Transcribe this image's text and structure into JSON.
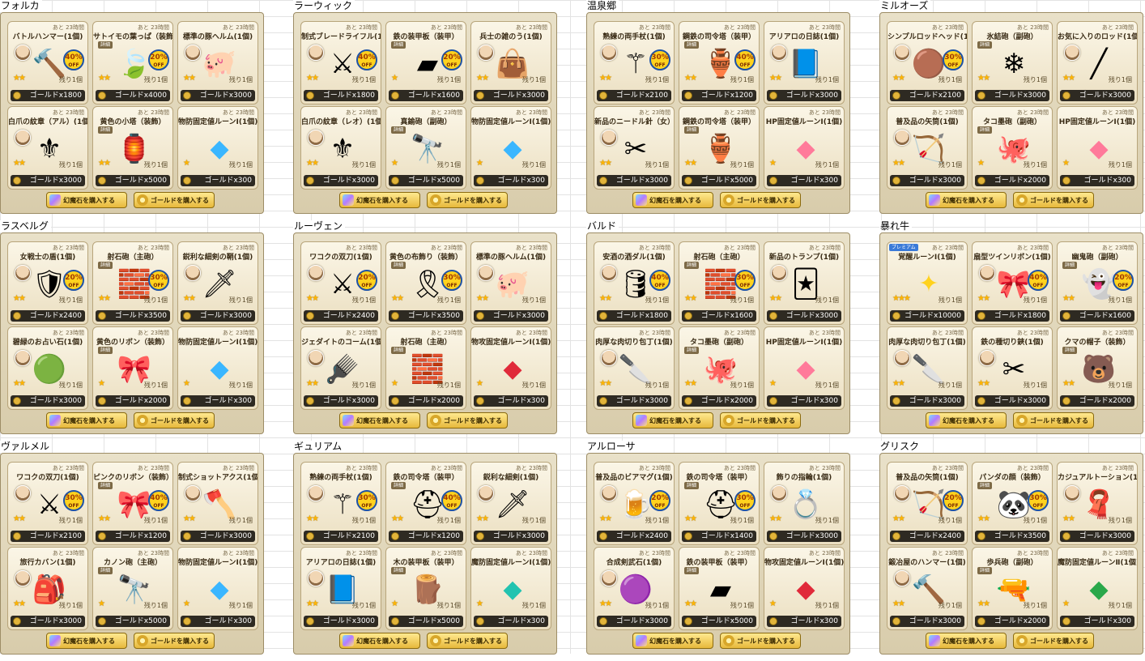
{
  "buttons": {
    "stone_label": "幻魔石を購入する",
    "gold_label": "ゴールドを購入する"
  },
  "common": {
    "remain_label": "あと 23時間",
    "detail_label": "詳細",
    "off_label": "OFF"
  },
  "shops": [
    {
      "title": "フォルカ",
      "items": [
        {
          "name": "バトルハンマー(1個)",
          "icon": "hammer-icon",
          "discount": "40%",
          "stars": "★★",
          "stock": "残り1個",
          "price": "ゴールドx1800",
          "portrait": true
        },
        {
          "name": "サトイモの葉っぱ（装飾）",
          "icon": "leaf-hat-icon",
          "discount": "20%",
          "stars": "★★",
          "stock": "残り1個",
          "price": "ゴールドx4000",
          "detail": true
        },
        {
          "name": "標準の豚ヘルム(1個)",
          "icon": "pig-helm-icon",
          "stars": "★★",
          "stock": "残り1個",
          "price": "ゴールドx3000",
          "portrait": true
        },
        {
          "name": "白爪の紋章（アル）(1個)",
          "icon": "crest-icon",
          "stars": "★★",
          "stock": "残り1個",
          "price": "ゴールドx3000",
          "portrait": true
        },
        {
          "name": "黄色の小塔（装飾）",
          "icon": "yellow-tower-icon",
          "stars": "★★",
          "stock": "残り1個",
          "price": "ゴールドx5000",
          "detail": true
        },
        {
          "name": "物防固定値ルーンⅠ(1個)",
          "icon": "blue-rune-icon",
          "stars": "★",
          "stock": "残り1個",
          "price": "ゴールドx300"
        }
      ]
    },
    {
      "title": "ラーウィック",
      "items": [
        {
          "name": "制式ブレードライフル(1個)",
          "icon": "blade-rifle-icon",
          "discount": "40%",
          "stars": "★★",
          "stock": "残り1個",
          "price": "ゴールドx1800",
          "portrait": true
        },
        {
          "name": "鉄の装甲板（装甲）",
          "icon": "armor-plate-icon",
          "discount": "20%",
          "stars": "★",
          "stock": "残り1個",
          "price": "ゴールドx1600",
          "detail": true
        },
        {
          "name": "兵士の雑のう(1個)",
          "icon": "bag-icon",
          "stars": "★★",
          "stock": "残り1個",
          "price": "ゴールドx3000",
          "portrait": true
        },
        {
          "name": "白爪の紋章（レオ）(1個)",
          "icon": "crest-icon",
          "stars": "★★",
          "stock": "残り1個",
          "price": "ゴールドx3000",
          "portrait": true
        },
        {
          "name": "真鍮砲（副砲）",
          "icon": "cannon-icon",
          "stars": "★",
          "stock": "残り1個",
          "price": "ゴールドx5000",
          "detail": true
        },
        {
          "name": "物防固定値ルーンⅠ(1個)",
          "icon": "blue-rune-icon",
          "stars": "★",
          "stock": "残り1個",
          "price": "ゴールドx300"
        }
      ]
    },
    {
      "title": "温泉郷",
      "items": [
        {
          "name": "熟練の両手杖(1個)",
          "icon": "staff-icon",
          "discount": "30%",
          "stars": "★★",
          "stock": "残り1個",
          "price": "ゴールドx2100",
          "portrait": true
        },
        {
          "name": "鋼鉄の司令塔（装甲）",
          "icon": "command-tower-icon",
          "discount": "40%",
          "stars": "★★",
          "stock": "残り1個",
          "price": "ゴールドx1200",
          "detail": true
        },
        {
          "name": "アリアロの日誌(1個)",
          "icon": "journal-icon",
          "stars": "★★",
          "stock": "残り1個",
          "price": "ゴールドx3000",
          "portrait": true
        },
        {
          "name": "新品のニードル針（女）(1個)",
          "icon": "needles-icon",
          "stars": "★★",
          "stock": "残り1個",
          "price": "ゴールドx3000",
          "portrait": true
        },
        {
          "name": "鋼鉄の司令塔（装甲）",
          "icon": "command-tower-icon",
          "stars": "★★",
          "stock": "残り1個",
          "price": "ゴールドx5000",
          "detail": true
        },
        {
          "name": "HP固定値ルーンⅠ(1個)",
          "icon": "pink-rune-icon",
          "stars": "★",
          "stock": "残り1個",
          "price": "ゴールドx300"
        }
      ]
    },
    {
      "title": "ミルオーズ",
      "items": [
        {
          "name": "シンプルロッドヘッド(1個)",
          "icon": "rod-head-icon",
          "discount": "30%",
          "stars": "★★",
          "stock": "残り1個",
          "price": "ゴールドx2100",
          "portrait": true
        },
        {
          "name": "氷結砲（副砲）",
          "icon": "ice-cannon-icon",
          "stars": "★★",
          "stock": "残り1個",
          "price": "ゴールドx3000",
          "detail": true
        },
        {
          "name": "お気に入りのロッド(1個)",
          "icon": "rod-icon",
          "stars": "★★",
          "stock": "残り1個",
          "price": "ゴールドx3000",
          "portrait": true
        },
        {
          "name": "普及品の矢筒(1個)",
          "icon": "quiver-icon",
          "stars": "★★",
          "stock": "残り1個",
          "price": "ゴールドx3000",
          "portrait": true
        },
        {
          "name": "タコ墨砲（副砲）",
          "icon": "octopus-cannon-icon",
          "stars": "★",
          "stock": "残り1個",
          "price": "ゴールドx2000",
          "detail": true
        },
        {
          "name": "HP固定値ルーンⅠ(1個)",
          "icon": "pink-rune-icon",
          "stars": "★",
          "stock": "残り1個",
          "price": "ゴールドx300"
        }
      ]
    },
    {
      "title": "ラスベルグ",
      "items": [
        {
          "name": "女戦士の盾(1個)",
          "icon": "shield-icon",
          "discount": "20%",
          "stars": "★★",
          "stock": "残り1個",
          "price": "ゴールドx2400",
          "portrait": true
        },
        {
          "name": "射石砲（主砲）",
          "icon": "stone-cannon-icon",
          "discount": "30%",
          "stars": "★★",
          "stock": "残り1個",
          "price": "ゴールドx3500",
          "detail": true
        },
        {
          "name": "鋭利な細剣の鞘(1個)",
          "icon": "sheath-icon",
          "stars": "★★",
          "stock": "残り1個",
          "price": "ゴールドx3000",
          "portrait": true
        },
        {
          "name": "碧緑のお占い石(1個)",
          "icon": "green-orb-icon",
          "stars": "★★",
          "stock": "残り1個",
          "price": "ゴールドx3000",
          "portrait": true
        },
        {
          "name": "黄色のリボン（装飾）",
          "icon": "yellow-ribbon-icon",
          "stars": "★",
          "stock": "残り1個",
          "price": "ゴールドx2000",
          "detail": true
        },
        {
          "name": "物防固定値ルーンⅠ(1個)",
          "icon": "blue-rune-icon",
          "stars": "★",
          "stock": "残り1個",
          "price": "ゴールドx300"
        }
      ]
    },
    {
      "title": "ルーヴェン",
      "items": [
        {
          "name": "ワコクの双刀(1個)",
          "icon": "twin-blades-icon",
          "discount": "20%",
          "stars": "★★",
          "stock": "残り1個",
          "price": "ゴールドx2400",
          "portrait": true
        },
        {
          "name": "黄色の布飾り（装飾）",
          "icon": "yellow-cloth-icon",
          "discount": "30%",
          "stars": "★★",
          "stock": "残り1個",
          "price": "ゴールドx3500",
          "detail": true
        },
        {
          "name": "標準の豚ヘルム(1個)",
          "icon": "pig-helm-icon",
          "stars": "★★",
          "stock": "残り1個",
          "price": "ゴールドx3000",
          "portrait": true
        },
        {
          "name": "ジェダイトのコーム(1個)",
          "icon": "comb-icon",
          "stars": "★★",
          "stock": "残り1個",
          "price": "ゴールドx3000",
          "portrait": true
        },
        {
          "name": "射石砲（主砲）",
          "icon": "stone-cannon-icon",
          "stars": "★",
          "stock": "残り1個",
          "price": "ゴールドx2000",
          "detail": true
        },
        {
          "name": "物攻固定値ルーンⅠ(1個)",
          "icon": "red-rune-icon",
          "stars": "★",
          "stock": "残り1個",
          "price": "ゴールドx300"
        }
      ]
    },
    {
      "title": "バルド",
      "items": [
        {
          "name": "安酒の酒ダル(1個)",
          "icon": "barrel-icon",
          "discount": "40%",
          "stars": "★★",
          "stock": "残り1個",
          "price": "ゴールドx1800",
          "portrait": true
        },
        {
          "name": "射石砲（主砲）",
          "icon": "stone-cannon-icon",
          "discount": "30%",
          "stars": "★★",
          "stock": "残り1個",
          "price": "ゴールドx1600",
          "detail": true
        },
        {
          "name": "新品のトランプ(1個)",
          "icon": "cards-icon",
          "stars": "★★",
          "stock": "残り1個",
          "price": "ゴールドx3000",
          "portrait": true
        },
        {
          "name": "肉厚な肉切り包丁(1個)",
          "icon": "cleaver-icon",
          "stars": "★★",
          "stock": "残り1個",
          "price": "ゴールドx3000",
          "portrait": true
        },
        {
          "name": "タコ墨砲（副砲）",
          "icon": "octopus-cannon-icon",
          "stars": "★★",
          "stock": "残り1個",
          "price": "ゴールドx2000",
          "detail": true
        },
        {
          "name": "HP固定値ルーンⅠ(1個)",
          "icon": "pink-rune-icon",
          "stars": "★",
          "stock": "残り1個",
          "price": "ゴールドx300"
        }
      ]
    },
    {
      "title": "暴れ牛",
      "items": [
        {
          "name": "覚醒ルーンⅠ(1個)",
          "icon": "awakening-rune-icon",
          "stars": "★★★",
          "stock": "残り1個",
          "price": "ゴールドx10000",
          "badge": "プレミアム"
        },
        {
          "name": "扇型ツインリボン(1個)",
          "icon": "twin-ribbon-icon",
          "discount": "40%",
          "stars": "★★",
          "stock": "残り1個",
          "price": "ゴールドx1800",
          "portrait": true
        },
        {
          "name": "幽鬼砲（副砲）",
          "icon": "ghost-cannon-icon",
          "discount": "20%",
          "stars": "★★",
          "stock": "残り1個",
          "price": "ゴールドx1600",
          "detail": true
        },
        {
          "name": "肉厚な肉切り包丁(1個)",
          "icon": "cleaver-icon",
          "stars": "★★",
          "stock": "残り1個",
          "price": "ゴールドx3000",
          "portrait": true
        },
        {
          "name": "鉄の種切り鋏(1個)",
          "icon": "scissors-icon",
          "stars": "★★",
          "stock": "残り1個",
          "price": "ゴールドx3000",
          "portrait": true
        },
        {
          "name": "クマの帽子（装飾）",
          "icon": "bear-hat-icon",
          "stars": "★★",
          "stock": "残り1個",
          "price": "ゴールドx2000",
          "detail": true
        }
      ]
    },
    {
      "title": "ヴァルメル",
      "items": [
        {
          "name": "ワコクの双刀(1個)",
          "icon": "twin-blades-icon",
          "discount": "30%",
          "stars": "★★",
          "stock": "残り1個",
          "price": "ゴールドx2100",
          "portrait": true
        },
        {
          "name": "ピンクのリボン（装飾）",
          "icon": "pink-ribbon-icon",
          "discount": "40%",
          "stars": "★★",
          "stock": "残り1個",
          "price": "ゴールドx1200",
          "detail": true
        },
        {
          "name": "制式ショットアクス(1個)",
          "icon": "axe-icon",
          "stars": "★★",
          "stock": "残り1個",
          "price": "ゴールドx3000",
          "portrait": true
        },
        {
          "name": "旅行カバン(1個)",
          "icon": "travel-bag-icon",
          "stars": "★★",
          "stock": "残り1個",
          "price": "ゴールドx3000",
          "portrait": true
        },
        {
          "name": "カノン砲（主砲）",
          "icon": "cannon-icon",
          "stars": "★",
          "stock": "残り1個",
          "price": "ゴールドx5000",
          "detail": true
        },
        {
          "name": "物防固定値ルーンⅠ(1個)",
          "icon": "blue-rune-icon",
          "stars": "★",
          "stock": "残り1個",
          "price": "ゴールドx300"
        }
      ]
    },
    {
      "title": "ギュリアム",
      "items": [
        {
          "name": "熟練の両手杖(1個)",
          "icon": "staff-icon",
          "discount": "30%",
          "stars": "★★",
          "stock": "残り1個",
          "price": "ゴールドx2100",
          "portrait": true
        },
        {
          "name": "鉄の司令塔（装甲）",
          "icon": "iron-tower-icon",
          "discount": "40%",
          "stars": "★★",
          "stock": "残り1個",
          "price": "ゴールドx1200",
          "detail": true
        },
        {
          "name": "鋭利な細剣(1個)",
          "icon": "rapier-icon",
          "stars": "★★",
          "stock": "残り1個",
          "price": "ゴールドx3000",
          "portrait": true
        },
        {
          "name": "アリアロの日誌(1個)",
          "icon": "journal-icon",
          "stars": "★★",
          "stock": "残り1個",
          "price": "ゴールドx3000",
          "portrait": true
        },
        {
          "name": "木の装甲板（装甲）",
          "icon": "wood-armor-icon",
          "stars": "★",
          "stock": "残り1個",
          "price": "ゴールドx5000",
          "detail": true
        },
        {
          "name": "魔防固定値ルーンⅠ(1個)",
          "icon": "teal-rune-icon",
          "stars": "★",
          "stock": "残り1個",
          "price": "ゴールドx300"
        }
      ]
    },
    {
      "title": "アルローサ",
      "items": [
        {
          "name": "普及品のビアマグ(1個)",
          "icon": "beer-mug-icon",
          "discount": "20%",
          "stars": "★★",
          "stock": "残り1個",
          "price": "ゴールドx2400",
          "portrait": true
        },
        {
          "name": "鉄の司令塔（装甲）",
          "icon": "iron-tower-icon",
          "discount": "30%",
          "stars": "★★",
          "stock": "残り1個",
          "price": "ゴールドx1400",
          "detail": true
        },
        {
          "name": "飾りの指輪(1個)",
          "icon": "ring-icon",
          "stars": "★★",
          "stock": "残り1個",
          "price": "ゴールドx3000",
          "portrait": true
        },
        {
          "name": "合成剣武石(1個)",
          "icon": "purple-orb-icon",
          "stars": "★★",
          "stock": "残り1個",
          "price": "ゴールドx3000",
          "portrait": true
        },
        {
          "name": "鉄の装甲板（装甲）",
          "icon": "armor-plate-icon",
          "stars": "★★",
          "stock": "残り1個",
          "price": "ゴールドx5000",
          "detail": true
        },
        {
          "name": "物攻固定値ルーンⅠ(1個)",
          "icon": "red-rune-icon",
          "stars": "★",
          "stock": "残り1個",
          "price": "ゴールドx300"
        }
      ]
    },
    {
      "title": "グリスク",
      "items": [
        {
          "name": "普及品の矢筒(1個)",
          "icon": "quiver-icon",
          "discount": "20%",
          "stars": "★★",
          "stock": "残り1個",
          "price": "ゴールドx2400",
          "portrait": true
        },
        {
          "name": "パンダの顔（装飾）",
          "icon": "panda-face-icon",
          "discount": "30%",
          "stars": "★★",
          "stock": "残り1個",
          "price": "ゴールドx3500",
          "detail": true
        },
        {
          "name": "カジュアルトーション(1個)",
          "icon": "scarf-icon",
          "stars": "★★",
          "stock": "残り1個",
          "price": "ゴールドx3000",
          "portrait": true
        },
        {
          "name": "鍛冶屋のハンマー(1個)",
          "icon": "smith-hammer-icon",
          "stars": "★★",
          "stock": "残り1個",
          "price": "ゴールドx3000",
          "portrait": true
        },
        {
          "name": "歩兵砲（副砲）",
          "icon": "infantry-cannon-icon",
          "stars": "★★",
          "stock": "残り1個",
          "price": "ゴールドx2000",
          "detail": true
        },
        {
          "name": "魔防固定値ルーンⅡ(1個)",
          "icon": "green-rune-icon",
          "stars": "★",
          "stock": "残り1個",
          "price": "ゴールドx300"
        }
      ]
    }
  ],
  "icon_glyphs": {
    "hammer-icon": "🔨",
    "leaf-hat-icon": "🍃",
    "pig-helm-icon": "🐖",
    "crest-icon": "⚜",
    "yellow-tower-icon": "🏮",
    "blue-rune-icon": "◆",
    "blade-rifle-icon": "⚔",
    "armor-plate-icon": "▰",
    "bag-icon": "👜",
    "cannon-icon": "🔭",
    "staff-icon": "⚚",
    "command-tower-icon": "🏺",
    "journal-icon": "📘",
    "needles-icon": "✂",
    "pink-rune-icon": "◆",
    "rod-head-icon": "🟤",
    "ice-cannon-icon": "❄",
    "rod-icon": "╱",
    "quiver-icon": "🏹",
    "octopus-cannon-icon": "🐙",
    "shield-icon": "🛡",
    "stone-cannon-icon": "🧱",
    "sheath-icon": "🗡",
    "green-orb-icon": "🟢",
    "yellow-ribbon-icon": "🎀",
    "twin-blades-icon": "⚔",
    "yellow-cloth-icon": "🎗",
    "comb-icon": "🪮",
    "red-rune-icon": "◆",
    "barrel-icon": "🛢",
    "cards-icon": "🃏",
    "cleaver-icon": "🔪",
    "awakening-rune-icon": "✦",
    "twin-ribbon-icon": "🎀",
    "ghost-cannon-icon": "👻",
    "scissors-icon": "✂",
    "bear-hat-icon": "🐻",
    "pink-ribbon-icon": "🎀",
    "axe-icon": "🪓",
    "travel-bag-icon": "🎒",
    "iron-tower-icon": "⛑",
    "rapier-icon": "🗡",
    "wood-armor-icon": "🪵",
    "teal-rune-icon": "◆",
    "beer-mug-icon": "🍺",
    "ring-icon": "💍",
    "purple-orb-icon": "🟣",
    "panda-face-icon": "🐼",
    "scarf-icon": "🧣",
    "smith-hammer-icon": "🔨",
    "infantry-cannon-icon": "🔫",
    "green-rune-icon": "◆"
  },
  "icon_colors": {
    "blue-rune-icon": "#3ab6ff",
    "pink-rune-icon": "#ff7a9a",
    "red-rune-icon": "#e02a3a",
    "teal-rune-icon": "#22c3b0",
    "green-rune-icon": "#2aa84a",
    "awakening-rune-icon": "#ffd21e"
  }
}
